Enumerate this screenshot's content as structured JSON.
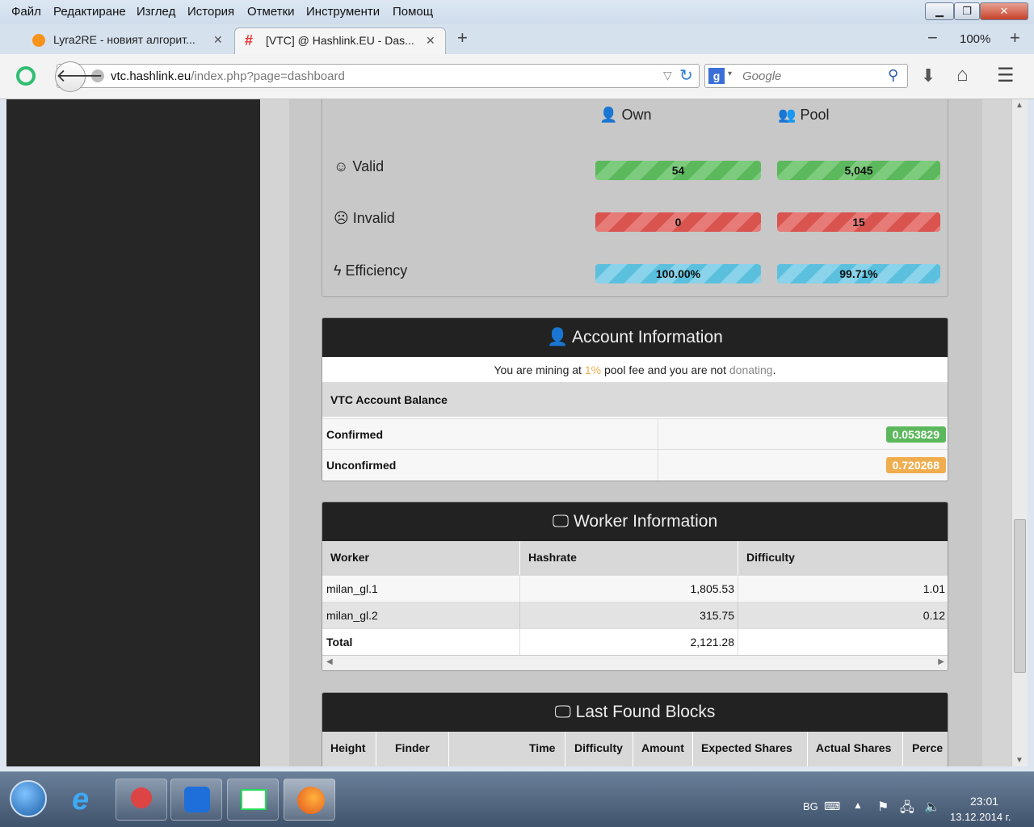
{
  "menu": [
    "Файл",
    "Редактиране",
    "Изглед",
    "История",
    "Отметки",
    "Инструменти",
    "Помощ"
  ],
  "tabs": [
    {
      "label": "Lyra2RE - новият алгорит...",
      "active": false
    },
    {
      "label": "[VTC] @ Hashlink.EU - Das...",
      "active": true
    }
  ],
  "zoom": "100%",
  "url": {
    "domain": "vtc.hashlink.eu",
    "path": "/index.php?page=dashboard"
  },
  "search": {
    "placeholder": "Google"
  },
  "stats": {
    "headers": {
      "own": "Own",
      "pool": "Pool"
    },
    "rows": [
      {
        "label": "Valid",
        "own": "54",
        "pool": "5,045",
        "color": "#5cb85c"
      },
      {
        "label": "Invalid",
        "own": "0",
        "pool": "15",
        "color": "#d9534f"
      },
      {
        "label": "Efficiency",
        "own": "100.00%",
        "pool": "99.71%",
        "color": "#5bc0de"
      }
    ]
  },
  "account": {
    "title": "Account Information",
    "notice": {
      "p1": "You are mining at ",
      "fee": "1%",
      "p2": " pool fee and you are not ",
      "donating": "donating",
      "p3": "."
    },
    "balance_title": "VTC Account Balance",
    "rows": [
      {
        "label": "Confirmed",
        "value": "0.053829",
        "color": "#5cb85c"
      },
      {
        "label": "Unconfirmed",
        "value": "0.720268",
        "color": "#f0ad4e"
      }
    ]
  },
  "workers": {
    "title": "Worker Information",
    "columns": [
      "Worker",
      "Hashrate",
      "Difficulty"
    ],
    "rows": [
      {
        "worker": "milan_gl.1",
        "hashrate": "1,805.53",
        "difficulty": "1.01"
      },
      {
        "worker": "milan_gl.2",
        "hashrate": "315.75",
        "difficulty": "0.12"
      }
    ],
    "total": {
      "label": "Total",
      "hashrate": "2,121.28"
    }
  },
  "blocks": {
    "title": "Last Found Blocks",
    "columns": [
      "Height",
      "Finder",
      "Time",
      "Difficulty",
      "Amount",
      "Expected Shares",
      "Actual Shares",
      "Perce"
    ]
  },
  "taskbar": {
    "lang": "BG",
    "time": "23:01",
    "date": "13.12.2014 г."
  }
}
